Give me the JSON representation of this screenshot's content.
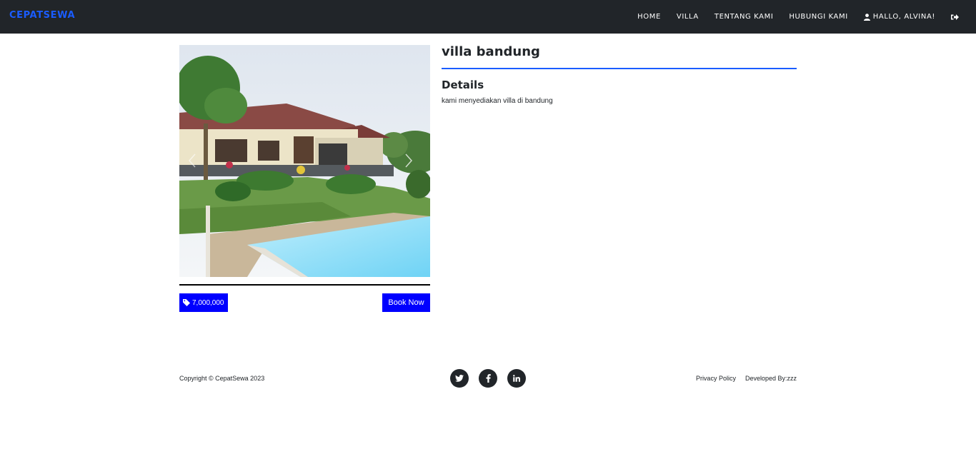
{
  "navbar": {
    "brand": "CEPATSEWA",
    "items": [
      {
        "label": "HOME"
      },
      {
        "label": "VILLA"
      },
      {
        "label": "TENTANG KAMI"
      },
      {
        "label": "HUBUNGI KAMI"
      },
      {
        "label": "HALLO, ALVINA!",
        "icon": "user-icon"
      }
    ],
    "logout_icon": "sign-out-icon"
  },
  "villa": {
    "title": "villa bandung",
    "details_heading": "Details",
    "description": "kami menyediakan villa di bandung",
    "price": "7,000,000",
    "price_icon": "tag-icon",
    "book_label": "Book Now"
  },
  "footer": {
    "copyright": "Copyright © CepatSewa 2023",
    "socials": [
      "twitter-icon",
      "facebook-icon",
      "linkedin-icon"
    ],
    "links": [
      "Privacy Policy",
      "Developed By:zzz"
    ]
  },
  "colors": {
    "navbar_bg": "#212529",
    "brand": "#1a5cff",
    "accent_button": "#0000ff",
    "title_rule": "#1a5cff"
  }
}
